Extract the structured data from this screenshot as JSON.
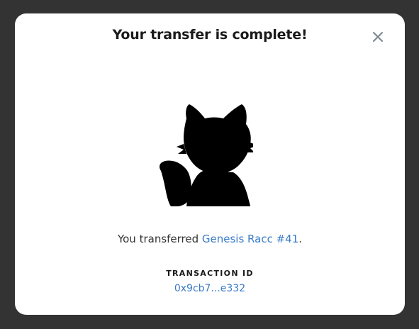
{
  "modal": {
    "title": "Your transfer is complete!",
    "close_icon": "close-icon"
  },
  "nft": {
    "image_icon": "raccoon-silhouette",
    "name": "Genesis Racc #41"
  },
  "message": {
    "prefix": "You transferred ",
    "suffix": "."
  },
  "transaction": {
    "label": "TRANSACTION ID",
    "id": "0x9cb7...e332"
  },
  "colors": {
    "backdrop": "#333333",
    "modal_bg": "#ffffff",
    "link": "#3a7bc8",
    "text": "#333333",
    "close_icon": "#7a8593"
  }
}
